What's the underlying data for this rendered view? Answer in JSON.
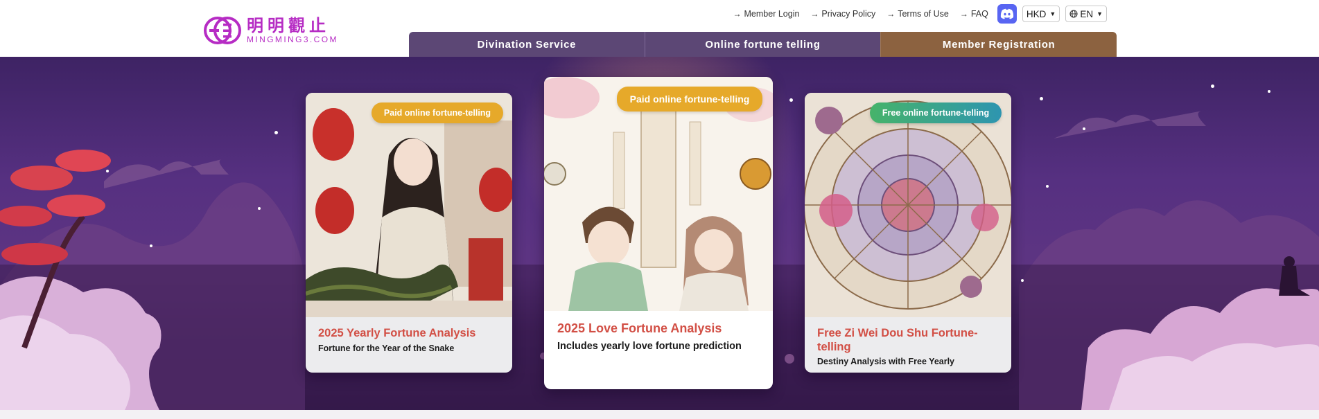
{
  "logo": {
    "cn": "明明觀止",
    "en": "MINGMING3.COM"
  },
  "topnav": {
    "links": [
      {
        "label": "Member Login"
      },
      {
        "label": "Privacy Policy"
      },
      {
        "label": "Terms of Use"
      },
      {
        "label": "FAQ"
      }
    ],
    "arrow": "→",
    "currency": "HKD",
    "language": "EN"
  },
  "mainnav": {
    "tabs": [
      "Divination Service",
      "Online fortune telling",
      "Member Registration"
    ]
  },
  "cards": [
    {
      "badge": "Paid online fortune-telling",
      "title": "2025 Yearly Fortune Analysis",
      "subtitle": "Fortune for the Year of the Snake"
    },
    {
      "badge": "Paid online fortune-telling",
      "title": "2025 Love Fortune Analysis",
      "subtitle": "Includes yearly love fortune prediction"
    },
    {
      "badge": "Free online fortune-telling",
      "title": "Free Zi Wei Dou Shu Fortune-telling",
      "subtitle": "Destiny Analysis with Free Yearly"
    }
  ],
  "colors": {
    "brand": "#b62cc4",
    "nav": "#5c4775",
    "nav_accent": "#8c6240",
    "badge_paid": "#e6a92a",
    "badge_free": "#3ea88a",
    "card_title": "#d24f45",
    "discord": "#5865f2"
  },
  "icons": [
    "arrow-right-icon",
    "discord-icon",
    "globe-icon",
    "caret-down-icon"
  ]
}
